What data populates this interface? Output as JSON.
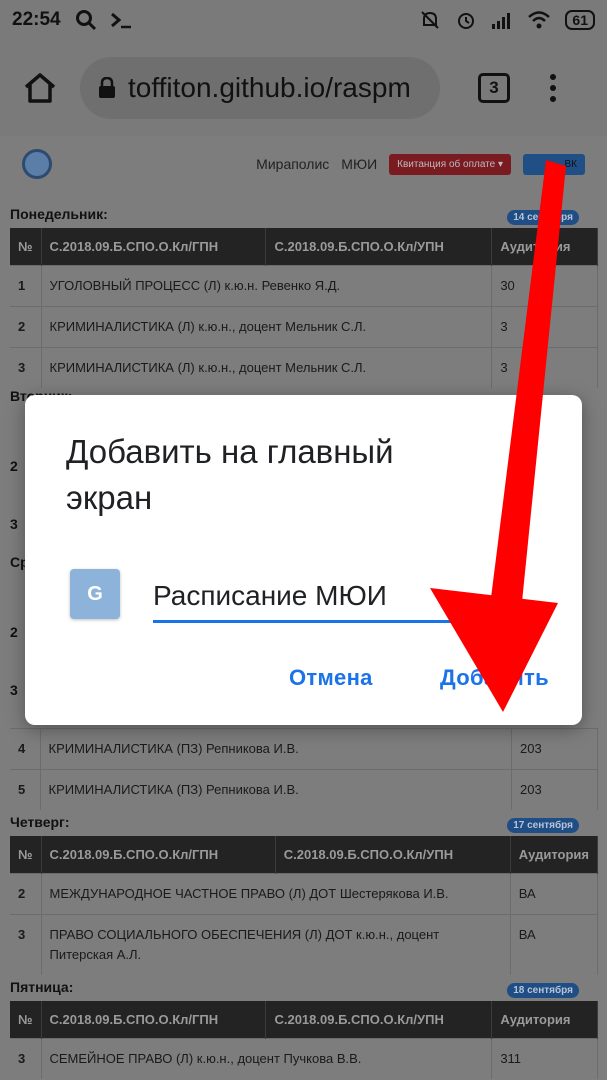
{
  "status_bar": {
    "time": "22:54",
    "battery": "61",
    "icons": [
      "search-icon",
      "terminal-icon",
      "mute-icon",
      "alarm-icon",
      "signal-icon",
      "wifi-icon",
      "battery-icon"
    ]
  },
  "browser": {
    "url": "toffiton.github.io/raspm",
    "tab_count": "3",
    "icons": [
      "home-icon",
      "lock-icon",
      "tabs-icon",
      "more-vert-icon"
    ]
  },
  "site_nav": {
    "link1": "Мираполис",
    "link2": "МЮИ",
    "receipt_button": "Квитанция об оплате ▾",
    "vk_button": "ВК"
  },
  "colors": {
    "dialog_accent": "#1a73e8",
    "receipt_button": "#c0272d",
    "vk_button": "#1a73e8",
    "date_badge": "#2a6fd6",
    "arrow": "#ff0000"
  },
  "schedule": {
    "headers": [
      "№",
      "С.2018.09.Б.СПО.О.Кл/ГПН",
      "С.2018.09.Б.СПО.О.Кл/УПН",
      "Аудитория"
    ],
    "monday": {
      "title": "Понедельник:",
      "date": "14 сентября",
      "rows": [
        {
          "num": "1",
          "subject": "УГОЛОВНЫЙ ПРОЦЕСС (Л) к.ю.н. Ревенко Я.Д.",
          "room": "30"
        },
        {
          "num": "2",
          "subject": "КРИМИНАЛИСТИКА (Л) к.ю.н., доцент Мельник С.Л.",
          "room": "3"
        },
        {
          "num": "3",
          "subject": "КРИМИНАЛИСТИКА (Л) к.ю.н., доцент Мельник С.Л.",
          "room": "3"
        }
      ]
    },
    "tuesday": {
      "title": "Вторник:",
      "row_nums": [
        "2",
        "3"
      ]
    },
    "wednesday": {
      "title": "Среда:",
      "row_nums": [
        "2",
        "3"
      ],
      "rows": [
        {
          "num": "4",
          "subject": "КРИМИНАЛИСТИКА (ПЗ) Репникова И.В.",
          "room": "203"
        },
        {
          "num": "5",
          "subject": "КРИМИНАЛИСТИКА (ПЗ) Репникова И.В.",
          "room": "203"
        }
      ]
    },
    "thursday": {
      "title": "Четверг:",
      "date": "17 сентября",
      "rows": [
        {
          "num": "2",
          "subject": "МЕЖДУНАРОДНОЕ ЧАСТНОЕ ПРАВО (Л) ДОТ Шестерякова И.В.",
          "room": "ВА"
        },
        {
          "num": "3",
          "subject": "ПРАВО СОЦИАЛЬНОГО ОБЕСПЕЧЕНИЯ (Л) ДОТ к.ю.н., доцент Питерская А.Л.",
          "room": "ВА"
        }
      ]
    },
    "friday": {
      "title": "Пятница:",
      "date": "18 сентября",
      "rows": [
        {
          "num": "3",
          "subject": "СЕМЕЙНОЕ ПРАВО (Л) к.ю.н., доцент Пучкова В.В.",
          "room": "311"
        }
      ]
    }
  },
  "dialog": {
    "title": "Добавить на главный экран",
    "app_icon_letter": "G",
    "name_value": "Расписание МЮИ",
    "cancel_label": "Отмена",
    "add_label": "Добавить"
  }
}
